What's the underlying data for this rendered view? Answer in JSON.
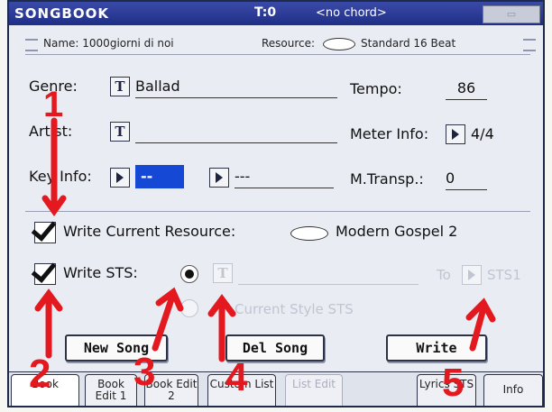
{
  "titlebar": {
    "app": "SONGBOOK",
    "tempo": "T:0",
    "chord": "<no chord>"
  },
  "namebar": {
    "name_label": "Name:",
    "name_value": "1000giorni di noi",
    "resource_label": "Resource:",
    "resource_value": "Standard 16 Beat"
  },
  "fields": {
    "genre_label": "Genre:",
    "genre_value": "Ballad",
    "tempo_label": "Tempo:",
    "tempo_value": "86",
    "artist_label": "Artist:",
    "artist_value": "",
    "meter_label": "Meter Info:",
    "meter_value": "4/4",
    "key_label": "Key Info:",
    "key_value": "--",
    "key_value2": "---",
    "mtransp_label": "M.Transp.:",
    "mtransp_value": "0"
  },
  "write_resource": {
    "label": "Write Current Resource:",
    "checked": true,
    "value": "Modern Gospel 2"
  },
  "write_sts": {
    "label": "Write STS:",
    "checked": true,
    "to_label": "To",
    "sts_label": "STS1",
    "current_style_label": "Current Style STS"
  },
  "buttons": {
    "new_song": "New Song",
    "del_song": "Del Song",
    "write": "Write"
  },
  "tabs": [
    {
      "label": "Book",
      "active": true,
      "enabled": true
    },
    {
      "label": "Book Edit 1",
      "active": false,
      "enabled": true
    },
    {
      "label": "Book Edit 2",
      "active": false,
      "enabled": true
    },
    {
      "label": "Custom List",
      "active": false,
      "enabled": true
    },
    {
      "label": "List Edit",
      "active": false,
      "enabled": false
    },
    {
      "label": "Lyrics STS",
      "active": false,
      "enabled": true
    },
    {
      "label": "Info",
      "active": false,
      "enabled": true
    }
  ],
  "annotations": [
    "1",
    "2",
    "3",
    "4",
    "5"
  ],
  "colors": {
    "titlebar": "#1f2f86",
    "highlight": "#1648d6",
    "annotation": "#e4191f"
  }
}
